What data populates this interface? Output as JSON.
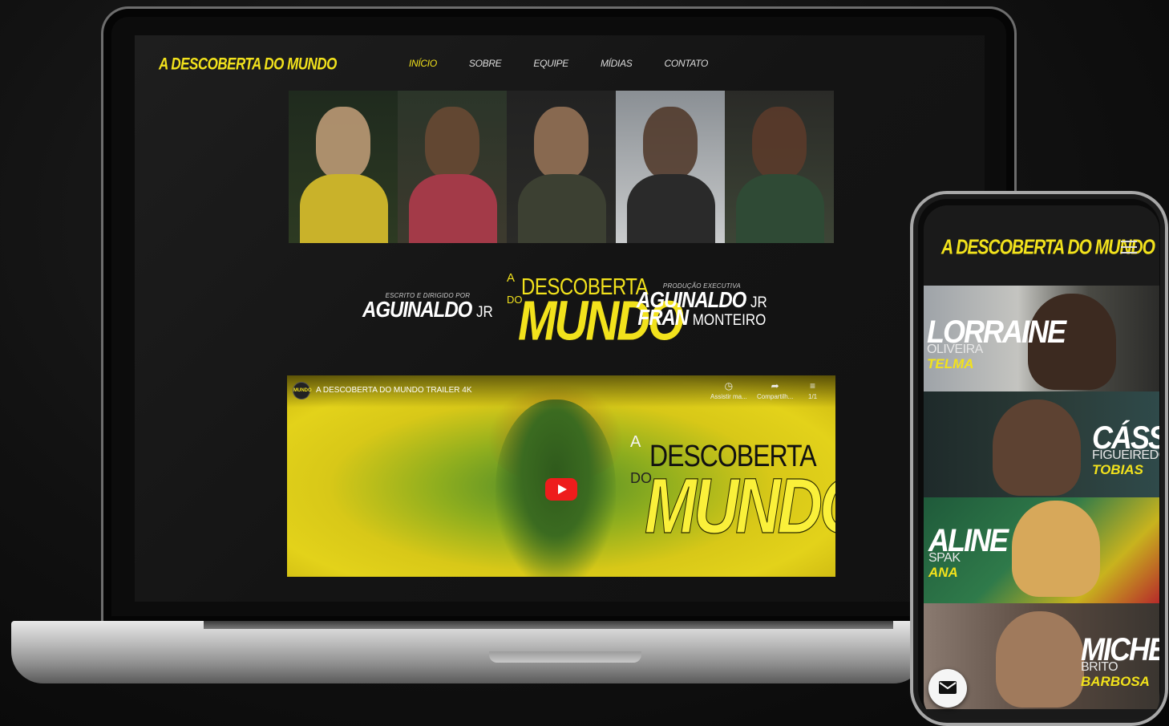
{
  "site": {
    "logo": "A DESCOBERTA DO MUNDO",
    "nav": [
      "INÍCIO",
      "SOBRE",
      "EQUIPE",
      "MÍDIAS",
      "CONTATO"
    ]
  },
  "credits": {
    "left_caption": "ESCRITO E DIRIGIDO POR",
    "left_name_bold": "AGUINALDO",
    "left_name_thin": "JR",
    "right_caption": "PRODUÇÃO EXECUTIVA",
    "right_name1_bold": "AGUINALDO",
    "right_name1_thin": "JR",
    "right_name2_bold": "FRAN",
    "right_name2_thin": "MONTEIRO"
  },
  "film_logo": {
    "a": "A",
    "descoberta": "DESCOBERTA",
    "do": "DO",
    "mundo": "MUNDO"
  },
  "video": {
    "channel_badge": "MUNDO",
    "title": "A DESCOBERTA DO MUNDO TRAILER 4K",
    "actions": [
      {
        "icon": "clock-icon",
        "glyph": "◷",
        "label": "Assistir ma..."
      },
      {
        "icon": "share-icon",
        "glyph": "➦",
        "label": "Compartilh..."
      },
      {
        "icon": "playlist-icon",
        "glyph": "≡",
        "label": "1/1"
      }
    ]
  },
  "phone": {
    "logo": "A DESCOBERTA DO MUNDO",
    "cast": [
      {
        "first": "LORRAINE",
        "last": "OLIVEIRA",
        "role": "TELMA"
      },
      {
        "first": "CÁSSIO",
        "last": "FIGUEIREDO",
        "role": "TOBIAS"
      },
      {
        "first": "ALINE",
        "last": "SPAK",
        "role": "ANA"
      },
      {
        "first": "MICHEL",
        "last": "BRITO",
        "role": "BARBOSA"
      }
    ]
  },
  "colors": {
    "accent": "#f2e21c",
    "background": "#111111",
    "play_button": "#ee1c1c"
  }
}
